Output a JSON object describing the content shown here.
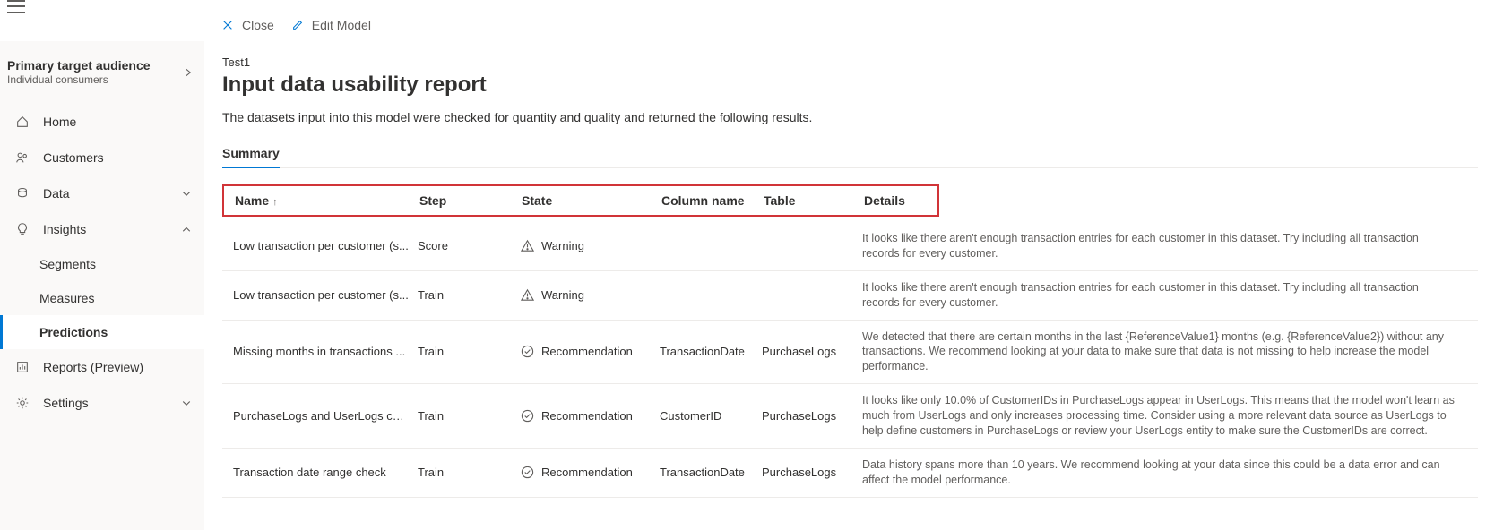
{
  "top_actions": {
    "close_label": "Close",
    "edit_label": "Edit Model"
  },
  "audience": {
    "title": "Primary target audience",
    "subtitle": "Individual consumers"
  },
  "nav": {
    "home": "Home",
    "customers": "Customers",
    "data": "Data",
    "insights": "Insights",
    "segments": "Segments",
    "measures": "Measures",
    "predictions": "Predictions",
    "reports": "Reports (Preview)",
    "settings": "Settings"
  },
  "page": {
    "breadcrumb": "Test1",
    "title": "Input data usability report",
    "description": "The datasets input into this model were checked for quantity and quality and returned the following results."
  },
  "tabs": {
    "summary": "Summary"
  },
  "table": {
    "headers": {
      "name": "Name",
      "step": "Step",
      "state": "State",
      "column": "Column name",
      "table": "Table",
      "details": "Details"
    },
    "rows": [
      {
        "name": "Low transaction per customer (s...",
        "step": "Score",
        "state": "Warning",
        "state_kind": "warning",
        "column": "",
        "table": "",
        "details": "It looks like there aren't enough transaction entries for each customer in this dataset. Try including all transaction records for every customer."
      },
      {
        "name": "Low transaction per customer (s...",
        "step": "Train",
        "state": "Warning",
        "state_kind": "warning",
        "column": "",
        "table": "",
        "details": "It looks like there aren't enough transaction entries for each customer in this dataset. Try including all transaction records for every customer."
      },
      {
        "name": "Missing months in transactions ...",
        "step": "Train",
        "state": "Recommendation",
        "state_kind": "recommendation",
        "column": "TransactionDate",
        "table": "PurchaseLogs",
        "details": "We detected that there are certain months in the last {ReferenceValue1} months (e.g. {ReferenceValue2}) without any transactions. We recommend looking at your data to make sure that data is not missing to help increase the model performance."
      },
      {
        "name": "PurchaseLogs and UserLogs cus...",
        "step": "Train",
        "state": "Recommendation",
        "state_kind": "recommendation",
        "column": "CustomerID",
        "table": "PurchaseLogs",
        "details": "It looks like only 10.0% of CustomerIDs in PurchaseLogs appear in UserLogs. This means that the model won't learn as much from UserLogs and only increases processing time. Consider using a more relevant data source as UserLogs to help define customers in PurchaseLogs or review your UserLogs entity to make sure the CustomerIDs are correct."
      },
      {
        "name": "Transaction date range check",
        "step": "Train",
        "state": "Recommendation",
        "state_kind": "recommendation",
        "column": "TransactionDate",
        "table": "PurchaseLogs",
        "details": "Data history spans more than 10 years. We recommend looking at your data since this could be a data error and can affect the model performance."
      }
    ]
  }
}
